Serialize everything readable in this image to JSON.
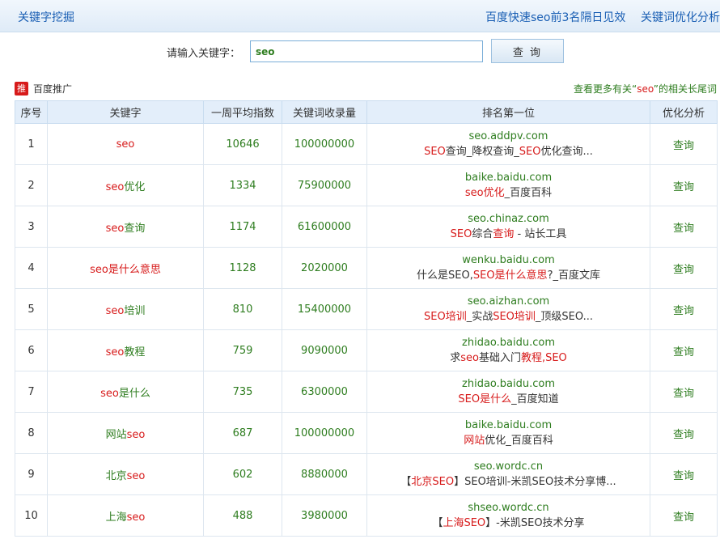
{
  "header": {
    "title": "关键字挖掘",
    "link1": "百度快速seo前3名隔日见效",
    "link2": "关键词优化分析"
  },
  "search": {
    "label": "请输入关键字：",
    "value": "seo",
    "button": "查 询"
  },
  "promo": {
    "badge": "推",
    "text": "百度推广"
  },
  "more": {
    "prefix": "查看更多有关“",
    "keyword": "seo",
    "suffix": "”的相关长尾词"
  },
  "table": {
    "headers": [
      "序号",
      "关键字",
      "一周平均指数",
      "关键词收录量",
      "排名第一位",
      "优化分析"
    ],
    "action_label": "查询",
    "rows": [
      {
        "no": "1",
        "kw": [
          [
            "seo",
            true
          ]
        ],
        "index": "10646",
        "count": "100000000",
        "domain": "seo.addpv.com",
        "desc": [
          [
            "SEO",
            true
          ],
          [
            "查询_降权查询_",
            false
          ],
          [
            "SEO",
            true
          ],
          [
            "优化查询...",
            false
          ]
        ]
      },
      {
        "no": "2",
        "kw": [
          [
            "seo",
            true
          ],
          [
            "优化",
            false
          ]
        ],
        "index": "1334",
        "count": "75900000",
        "domain": "baike.baidu.com",
        "desc": [
          [
            "seo优化",
            true
          ],
          [
            "_百度百科",
            false
          ]
        ]
      },
      {
        "no": "3",
        "kw": [
          [
            "seo",
            true
          ],
          [
            "查询",
            false
          ]
        ],
        "index": "1174",
        "count": "61600000",
        "domain": "seo.chinaz.com",
        "desc": [
          [
            "SEO",
            true
          ],
          [
            "综合",
            false
          ],
          [
            "查询",
            true
          ],
          [
            " - 站长工具",
            false
          ]
        ]
      },
      {
        "no": "4",
        "kw": [
          [
            "seo是什么意思",
            true
          ]
        ],
        "index": "1128",
        "count": "2020000",
        "domain": "wenku.baidu.com",
        "desc": [
          [
            "什么是SEO,",
            false
          ],
          [
            "SEO是什么意思",
            true
          ],
          [
            "?_百度文库",
            false
          ]
        ]
      },
      {
        "no": "5",
        "kw": [
          [
            "seo",
            true
          ],
          [
            "培训",
            false
          ]
        ],
        "index": "810",
        "count": "15400000",
        "domain": "seo.aizhan.com",
        "desc": [
          [
            "SEO培训",
            true
          ],
          [
            "_实战",
            false
          ],
          [
            "SEO培训",
            true
          ],
          [
            "_顶级SEO...",
            false
          ]
        ]
      },
      {
        "no": "6",
        "kw": [
          [
            "seo",
            true
          ],
          [
            "教程",
            false
          ]
        ],
        "index": "759",
        "count": "9090000",
        "domain": "zhidao.baidu.com",
        "desc": [
          [
            "求",
            false
          ],
          [
            "seo",
            true
          ],
          [
            "基础入门",
            false
          ],
          [
            "教程,SEO",
            true
          ]
        ]
      },
      {
        "no": "7",
        "kw": [
          [
            "seo",
            true
          ],
          [
            "是什么",
            false
          ]
        ],
        "index": "735",
        "count": "6300000",
        "domain": "zhidao.baidu.com",
        "desc": [
          [
            "SEO是什么",
            true
          ],
          [
            "_百度知道",
            false
          ]
        ]
      },
      {
        "no": "8",
        "kw": [
          [
            "网站",
            false
          ],
          [
            "seo",
            true
          ]
        ],
        "index": "687",
        "count": "100000000",
        "domain": "baike.baidu.com",
        "desc": [
          [
            "网站",
            true
          ],
          [
            "优化_百度百科",
            false
          ]
        ]
      },
      {
        "no": "9",
        "kw": [
          [
            "北京",
            false
          ],
          [
            "seo",
            true
          ]
        ],
        "index": "602",
        "count": "8880000",
        "domain": "seo.wordc.cn",
        "desc": [
          [
            "【",
            false
          ],
          [
            "北京SEO",
            true
          ],
          [
            "】SEO培训-米凯SEO技术分享博...",
            false
          ]
        ]
      },
      {
        "no": "10",
        "kw": [
          [
            "上海",
            false
          ],
          [
            "seo",
            true
          ]
        ],
        "index": "488",
        "count": "3980000",
        "domain": "shseo.wordc.cn",
        "desc": [
          [
            "【",
            false
          ],
          [
            "上海SEO",
            true
          ],
          [
            "】-米凯SEO技术分享",
            false
          ]
        ]
      }
    ]
  },
  "colors": {
    "green": "#2e7d1f",
    "red": "#d71b1b",
    "header_blue": "#1a5fb4",
    "table_header_bg": "#e3eefa"
  }
}
